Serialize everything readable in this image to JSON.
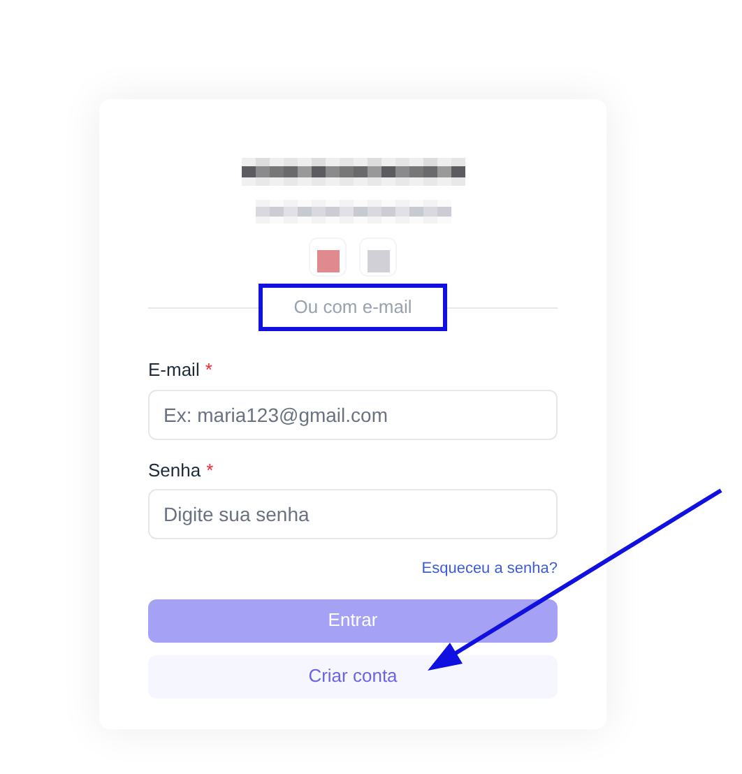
{
  "header": {
    "title_redacted": true,
    "subtitle_redacted": true
  },
  "social_buttons": [
    {
      "color": "#e08a8f"
    },
    {
      "color": "#d0d0d6"
    }
  ],
  "divider": {
    "label": "Ou com e-mail",
    "highlighted": true
  },
  "fields": [
    {
      "label": "E-mail",
      "required_mark": "*",
      "placeholder": "Ex: maria123@gmail.com"
    },
    {
      "label": "Senha",
      "required_mark": "*",
      "placeholder": "Digite sua senha"
    }
  ],
  "forgot_link": "Esqueceu a senha?",
  "submit": {
    "label": "Entrar",
    "disabled": true
  },
  "create_account": {
    "label": "Criar conta"
  },
  "annotation_arrow": true
}
